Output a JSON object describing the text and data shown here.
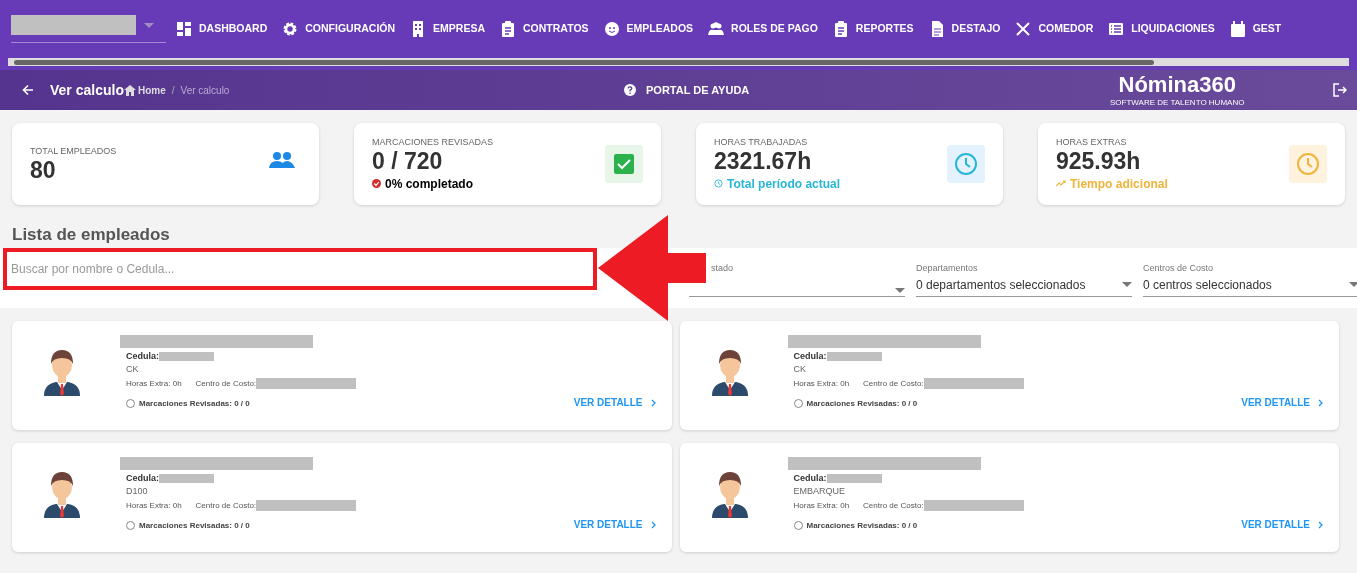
{
  "nav": {
    "items": [
      {
        "label": "DASHBOARD"
      },
      {
        "label": "CONFIGURACIÓN"
      },
      {
        "label": "EMPRESA"
      },
      {
        "label": "CONTRATOS"
      },
      {
        "label": "EMPLEADOS"
      },
      {
        "label": "ROLES DE PAGO"
      },
      {
        "label": "REPORTES"
      },
      {
        "label": "DESTAJO"
      },
      {
        "label": "COMEDOR"
      },
      {
        "label": "LIQUIDACIONES"
      },
      {
        "label": "GEST"
      }
    ]
  },
  "header": {
    "title": "Ver calculo",
    "breadcrumb": [
      "Home",
      "Ver calculo"
    ],
    "breadcrumb_separator": "/",
    "help": "PORTAL DE AYUDA",
    "logo": "Nómina360",
    "logo_tagline": "SOFTWARE DE TALENTO HUMANO"
  },
  "stats": [
    {
      "label": "TOTAL EMPLEADOS",
      "value": "80"
    },
    {
      "label": "MARCACIONES REVISADAS",
      "value": "0 / 720",
      "note": "0% completado"
    },
    {
      "label": "HORAS TRABAJADAS",
      "value": "2321.67h",
      "note": "Total período actual"
    },
    {
      "label": "HORAS EXTRAS",
      "value": "925.93h",
      "note": "Tiempo adicional"
    }
  ],
  "list_title": "Lista de empleados",
  "filters": {
    "search_placeholder": "Buscar por nombre o Cedula...",
    "selects": [
      {
        "label": "stado"
      },
      {
        "label": "Departamentos",
        "value": "0 departamentos seleccionados"
      },
      {
        "label": "Centros de Costo",
        "value": "0 centros seleccionados"
      }
    ]
  },
  "employees": [
    {
      "cedula_label": "Cedula:",
      "department": "CK",
      "extra": "Horas Extra: 0h",
      "cost_label": "Centro de Costo:",
      "reviewed": "Marcaciones Revisadas: 0 / 0",
      "reviewed_checked": false,
      "action": "VER DETALLE"
    },
    {
      "cedula_label": "Cedula:",
      "department": "CK",
      "extra": "Horas Extra: 0h",
      "cost_label": "Centro de Costo:",
      "reviewed": "Marcaciones Revisadas: 0 / 0",
      "reviewed_checked": false,
      "action": "VER DETALLE"
    },
    {
      "cedula_label": "Cedula:",
      "department": "D100",
      "extra": "Horas Extra: 0h",
      "cost_label": "Centro de Costo:",
      "reviewed": "Marcaciones Revisadas: 0 / 0",
      "reviewed_checked": false,
      "action": "VER DETALLE"
    },
    {
      "cedula_label": "Cedula:",
      "department": "EMBARQUE",
      "extra": "Horas Extra: 0h",
      "cost_label": "Centro de Costo:",
      "reviewed": "Marcaciones Revisadas: 0 / 0",
      "reviewed_checked": false,
      "action": "VER DETALLE"
    }
  ]
}
